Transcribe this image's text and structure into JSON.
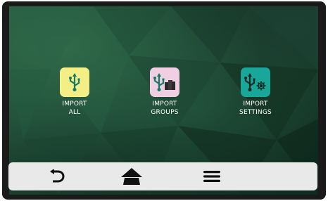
{
  "tiles": [
    {
      "line1": "IMPORT",
      "line2": "ALL",
      "color": "#f4ee86",
      "icon": "usb-icon"
    },
    {
      "line1": "IMPORT",
      "line2": "GROUPS",
      "color": "#f0cfe2",
      "icon": "usb-groups-icon"
    },
    {
      "line1": "IMPORT",
      "line2": "SETTINGS",
      "color": "#19a799",
      "icon": "usb-settings-icon"
    }
  ],
  "navbar": {
    "back_icon": "back-arrow-icon",
    "home_icon": "home-icon",
    "menu_icon": "hamburger-menu-icon"
  },
  "colors": {
    "background": "#1f4d38",
    "navbar": "#e9e9ea",
    "label": "#ffffff"
  }
}
